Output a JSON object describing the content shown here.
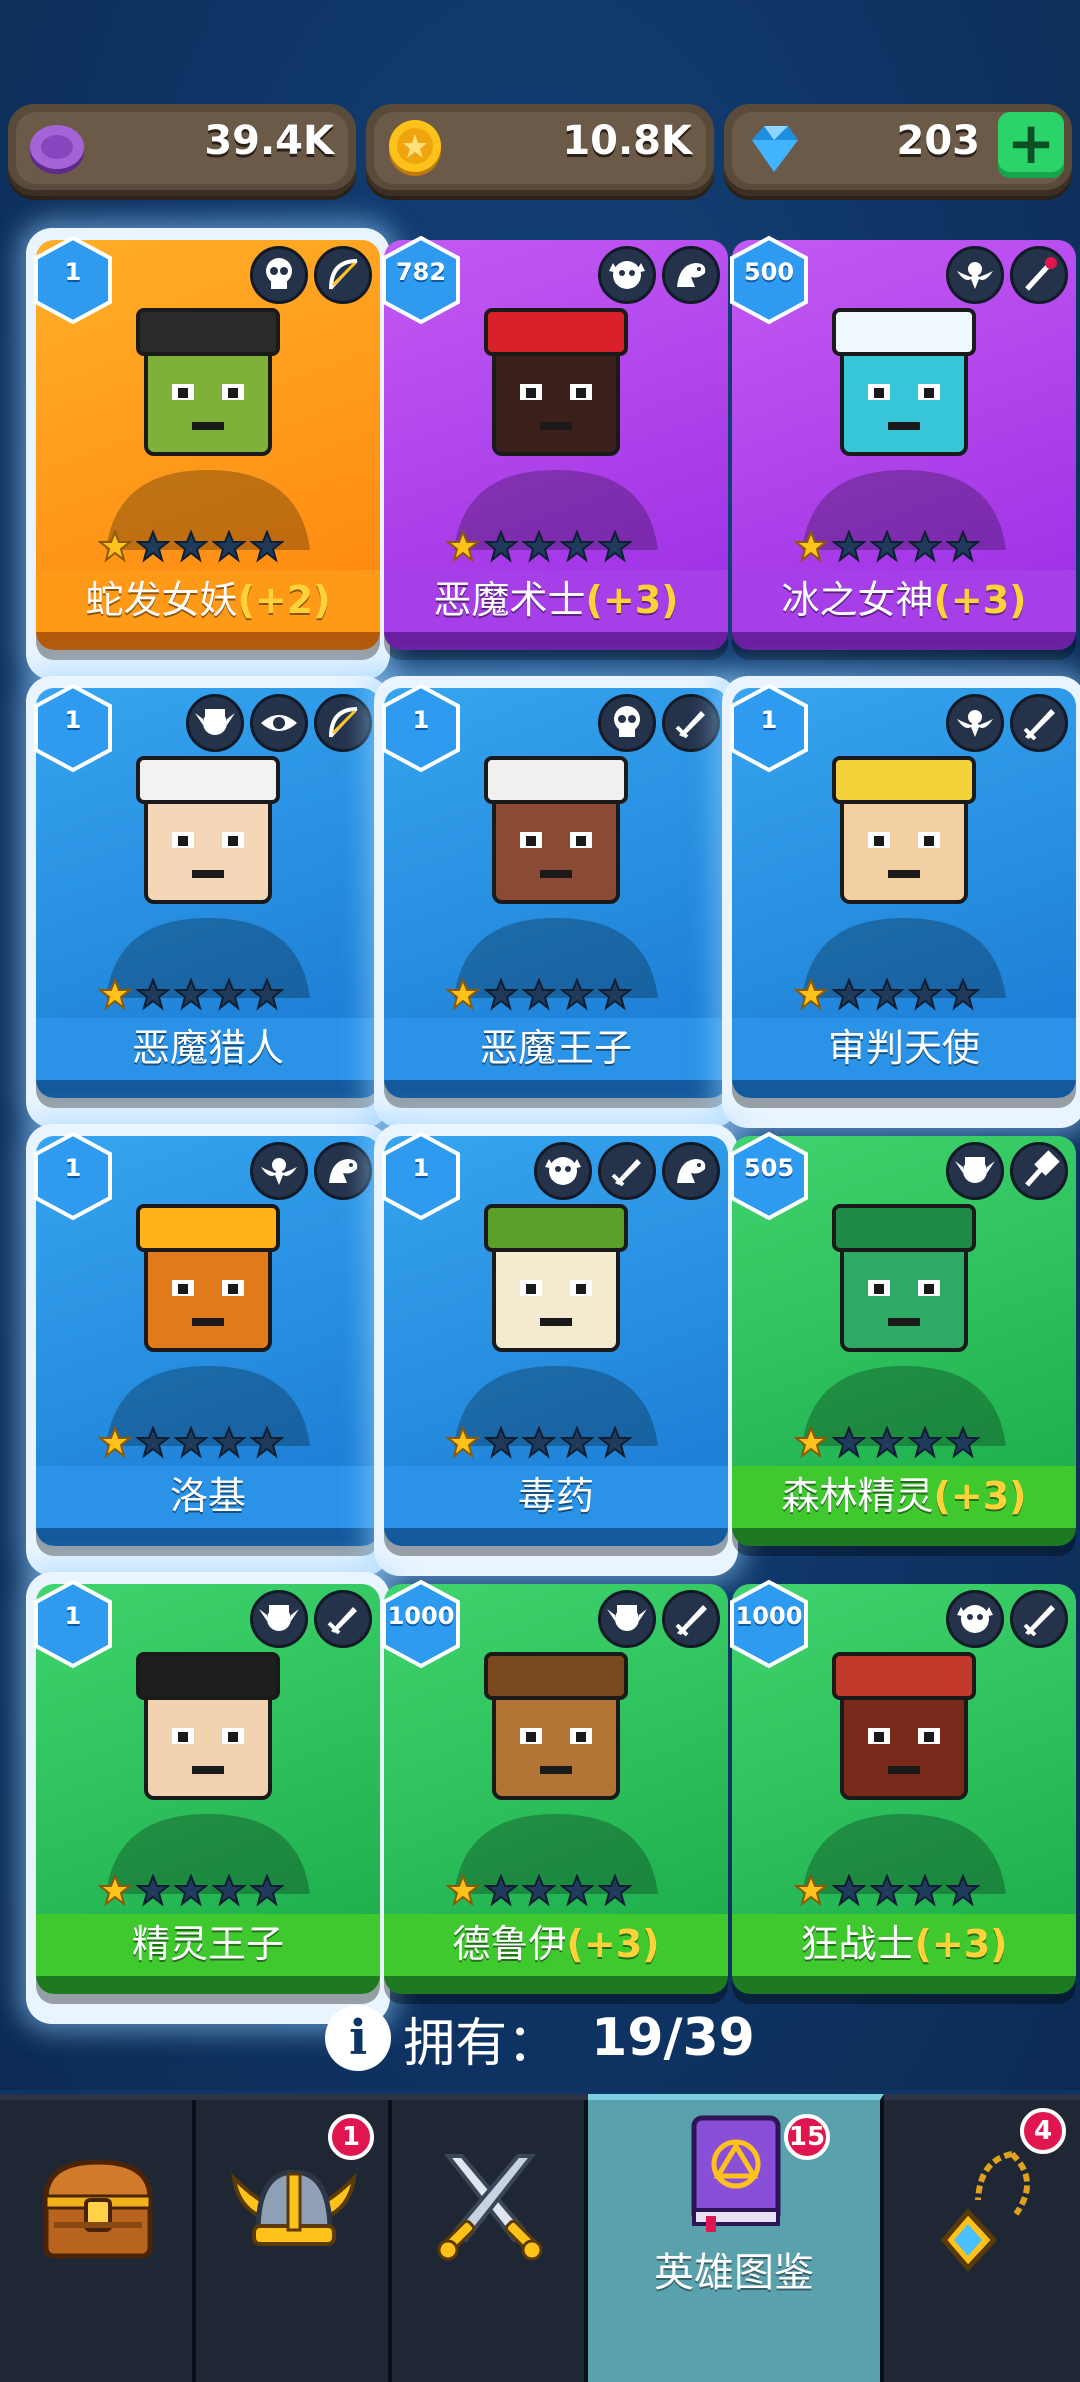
{
  "currencies": [
    {
      "name": "purple-coin",
      "icon": "purple-token-icon",
      "amount": "39.4K"
    },
    {
      "name": "gold-coin",
      "icon": "gold-coin-icon",
      "amount": "10.8K"
    },
    {
      "name": "gems",
      "icon": "diamond-icon",
      "amount": "203",
      "add_label": "+"
    }
  ],
  "heroes": [
    {
      "name": "蛇发女妖",
      "bonus": "(+2)",
      "level": "1",
      "rarity": "orange",
      "stars": 1,
      "owned": true,
      "classes": [
        "skull-icon",
        "bow-icon"
      ],
      "colors": {
        "skin": "#7fb03a",
        "hair": "#2a2a2a"
      }
    },
    {
      "name": "恶魔术士",
      "bonus": "(+3)",
      "level": "782",
      "rarity": "purple",
      "stars": 1,
      "owned": false,
      "classes": [
        "orc-icon",
        "dragon-icon"
      ],
      "colors": {
        "skin": "#3a1f1a",
        "hair": "#d8202a"
      }
    },
    {
      "name": "冰之女神",
      "bonus": "(+3)",
      "level": "500",
      "rarity": "purple",
      "stars": 1,
      "owned": false,
      "classes": [
        "angel-icon",
        "staff-icon"
      ],
      "colors": {
        "skin": "#37c6d8",
        "hair": "#f0f8ff"
      }
    },
    {
      "name": "恶魔猎人",
      "bonus": "",
      "level": "1",
      "rarity": "blue",
      "stars": 1,
      "owned": true,
      "classes": [
        "elf-icon",
        "eye-icon",
        "bow-icon"
      ],
      "colors": {
        "skin": "#f5d6b8",
        "hair": "#f2f2f2"
      }
    },
    {
      "name": "恶魔王子",
      "bonus": "",
      "level": "1",
      "rarity": "blue",
      "stars": 1,
      "owned": true,
      "classes": [
        "skull-icon",
        "dagger-icon"
      ],
      "colors": {
        "skin": "#8a4a34",
        "hair": "#f0f0f0"
      }
    },
    {
      "name": "审判天使",
      "bonus": "",
      "level": "1",
      "rarity": "blue",
      "stars": 1,
      "owned": true,
      "classes": [
        "angel-icon",
        "sword-icon"
      ],
      "colors": {
        "skin": "#f2cfa0",
        "hair": "#f3d23a"
      }
    },
    {
      "name": "洛基",
      "bonus": "",
      "level": "1",
      "rarity": "blue",
      "stars": 1,
      "owned": true,
      "classes": [
        "angel-icon",
        "dragon-icon"
      ],
      "colors": {
        "skin": "#e07a1a",
        "hair": "#ffb21a"
      }
    },
    {
      "name": "毒药",
      "bonus": "",
      "level": "1",
      "rarity": "blue",
      "stars": 1,
      "owned": true,
      "classes": [
        "orc-icon",
        "dagger-icon",
        "dragon-icon"
      ],
      "colors": {
        "skin": "#f3ead0",
        "hair": "#5aa02a"
      }
    },
    {
      "name": "森林精灵",
      "bonus": "(+3)",
      "level": "505",
      "rarity": "green",
      "stars": 1,
      "owned": false,
      "classes": [
        "elf-icon",
        "hammer-icon"
      ],
      "colors": {
        "skin": "#2faa64",
        "hair": "#1e8a48"
      }
    },
    {
      "name": "精灵王子",
      "bonus": "",
      "level": "1",
      "rarity": "green",
      "stars": 1,
      "owned": true,
      "classes": [
        "elf-icon",
        "dagger-icon"
      ],
      "colors": {
        "skin": "#f2d2b0",
        "hair": "#1e1e1e"
      }
    },
    {
      "name": "德鲁伊",
      "bonus": "(+3)",
      "level": "1000",
      "rarity": "green",
      "stars": 1,
      "owned": false,
      "classes": [
        "elf-icon",
        "sword-icon"
      ],
      "colors": {
        "skin": "#b07434",
        "hair": "#7a4a1e"
      }
    },
    {
      "name": "狂战士",
      "bonus": "(+3)",
      "level": "1000",
      "rarity": "green",
      "stars": 1,
      "owned": false,
      "classes": [
        "orc-icon",
        "sword-icon"
      ],
      "colors": {
        "skin": "#7a2a1a",
        "hair": "#c23a2a"
      }
    }
  ],
  "collection": {
    "label": "拥有：",
    "count": "19/39",
    "info_icon": "i"
  },
  "nav": [
    {
      "name": "chest",
      "icon": "chest-icon",
      "label": "",
      "badge": ""
    },
    {
      "name": "heroes",
      "icon": "viking-helmet-icon",
      "label": "",
      "badge": "1"
    },
    {
      "name": "battle",
      "icon": "crossed-swords-icon",
      "label": "",
      "badge": ""
    },
    {
      "name": "hero-guide",
      "icon": "spellbook-icon",
      "label": "英雄图鉴",
      "badge": "15",
      "active": true
    },
    {
      "name": "amulet",
      "icon": "amulet-icon",
      "label": "",
      "badge": "4"
    }
  ],
  "theme": {
    "background": "#0f3566",
    "star_active": "#ffc21a",
    "star_inactive": "#1f3a5a"
  }
}
